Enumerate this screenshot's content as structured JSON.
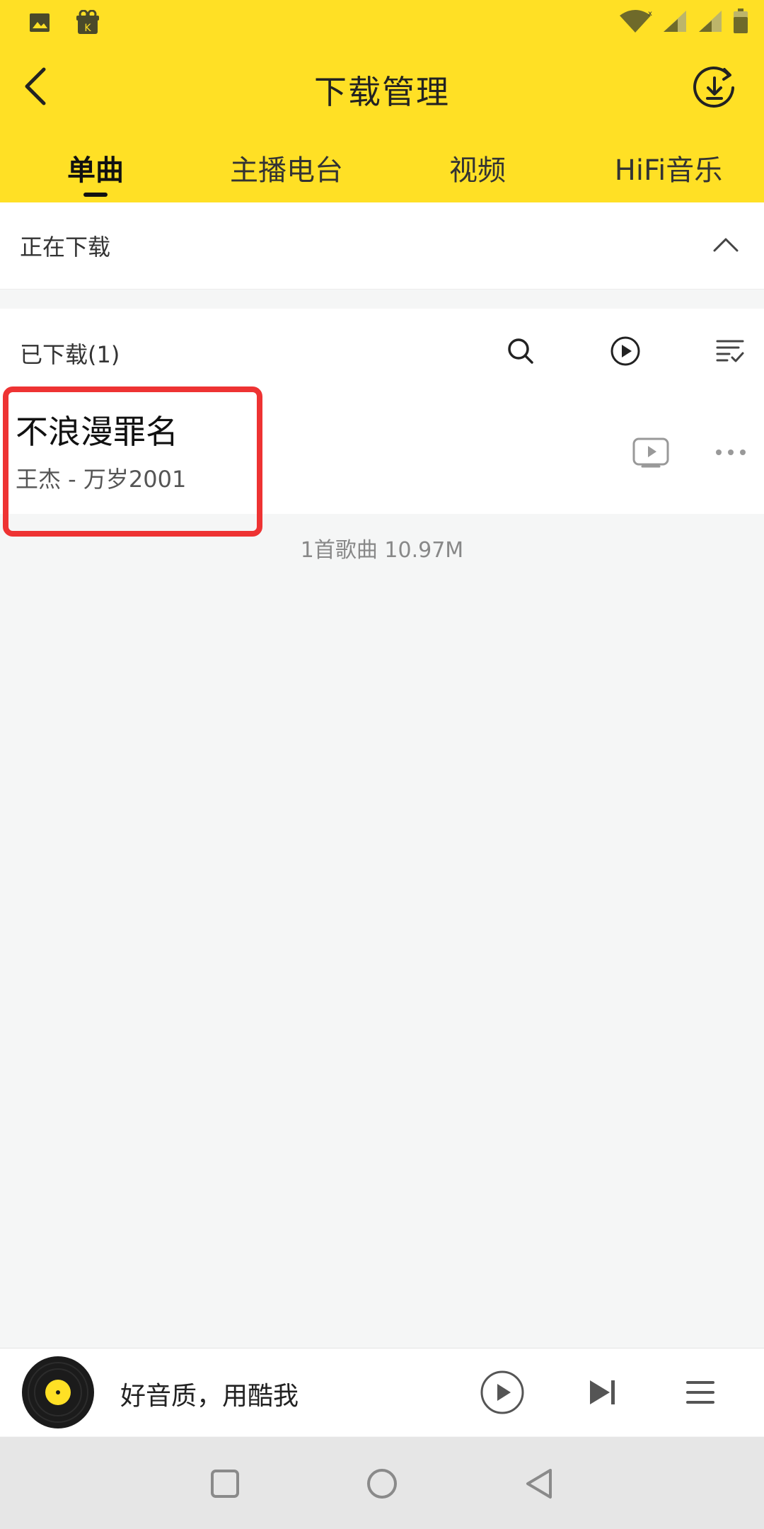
{
  "header": {
    "title": "下载管理",
    "tabs": [
      {
        "label": "单曲",
        "active": true
      },
      {
        "label": "主播电台",
        "active": false
      },
      {
        "label": "视频",
        "active": false
      },
      {
        "label": "HiFi音乐",
        "active": false
      }
    ],
    "status_icons": [
      "image-icon",
      "app-gift-icon",
      "wifi-icon",
      "signal-icon",
      "signal-icon",
      "battery-icon"
    ]
  },
  "downloading": {
    "label": "正在下载",
    "icon": "chevron-up-icon"
  },
  "downloaded": {
    "label": "已下载(1)",
    "tools": [
      "search-icon",
      "play-circle-icon",
      "sort-list-icon"
    ]
  },
  "songs": [
    {
      "title": "不浪漫罪名",
      "subtitle": "王杰 - 万岁2001"
    }
  ],
  "summary": "1首歌曲 10.97M",
  "player": {
    "text": "好音质，用酷我"
  },
  "colors": {
    "brand_yellow": "#ffe025",
    "highlight_red": "#ee3333",
    "background": "#f5f6f6"
  }
}
